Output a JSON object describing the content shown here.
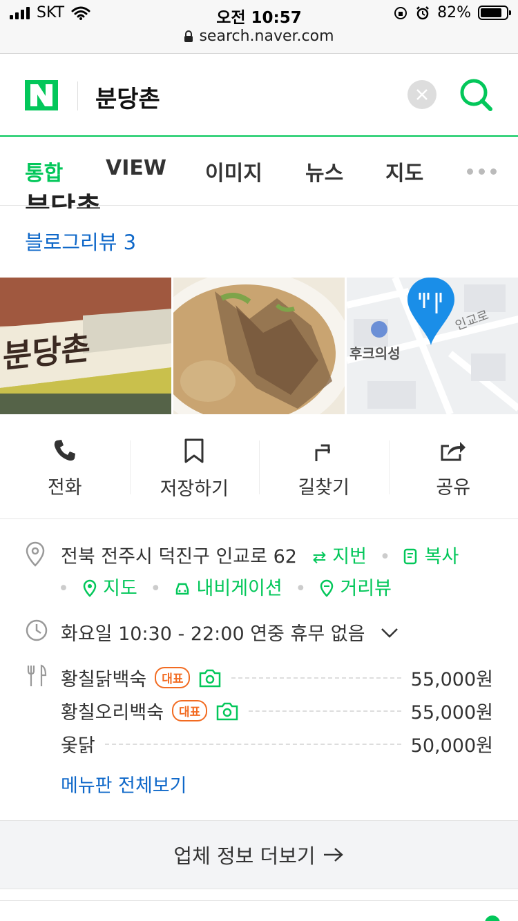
{
  "status_bar": {
    "carrier": "SKT",
    "time": "오전 10:57",
    "battery": "82%",
    "battery_level": 0.82,
    "url": "search.naver.com"
  },
  "search": {
    "logo": "N",
    "query": "분당촌"
  },
  "tabs": [
    {
      "label": "통합",
      "active": true
    },
    {
      "label": "VIEW",
      "active": false
    },
    {
      "label": "이미지",
      "active": false
    },
    {
      "label": "뉴스",
      "active": false
    },
    {
      "label": "지도",
      "active": false
    }
  ],
  "place": {
    "blog_review": "블로그리뷰 3",
    "photo_sign_text": "분당촌",
    "map_poi": "후크의성",
    "map_road": "인교로"
  },
  "actions": [
    {
      "label": "전화",
      "icon": "phone-icon"
    },
    {
      "label": "저장하기",
      "icon": "bookmark-icon"
    },
    {
      "label": "길찾기",
      "icon": "directions-icon"
    },
    {
      "label": "공유",
      "icon": "share-icon"
    }
  ],
  "address": {
    "text": "전북 전주시 덕진구 인교로 62",
    "jibun": "지번",
    "copy": "복사",
    "map": "지도",
    "navigation": "내비게이션",
    "street_view": "거리뷰"
  },
  "hours": {
    "text": "화요일 10:30 - 22:00 연중 휴무 없음"
  },
  "menu": {
    "items": [
      {
        "name": "황칠닭백숙",
        "badge": "대표",
        "price": "55,000원"
      },
      {
        "name": "황칠오리백숙",
        "badge": "대표",
        "price": "55,000원"
      },
      {
        "name": "옻닭",
        "badge": "",
        "price": "50,000원"
      }
    ],
    "view_all": "메뉴판 전체보기"
  },
  "more_info": "업체 정보 더보기",
  "colors": {
    "naver_green": "#03c75a",
    "link_blue": "#0f68c9",
    "badge_orange": "#f26b21"
  }
}
